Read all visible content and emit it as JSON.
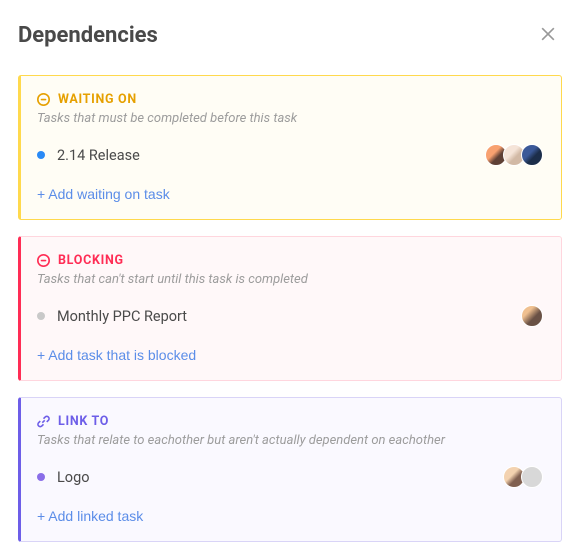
{
  "header": {
    "title": "Dependencies"
  },
  "sections": {
    "waiting": {
      "label": "WAITING ON",
      "description": "Tasks that must be completed before this task",
      "task": "2.14 Release",
      "add": "+ Add waiting on task"
    },
    "blocking": {
      "label": "BLOCKING",
      "description": "Tasks that can't start until this task is completed",
      "task": "Monthly PPC Report",
      "add": "+ Add task that is blocked"
    },
    "linkto": {
      "label": "LINK TO",
      "description": "Tasks that relate to eachother but aren't actually dependent on eachother",
      "task": "Logo",
      "add": "+ Add linked task"
    }
  }
}
